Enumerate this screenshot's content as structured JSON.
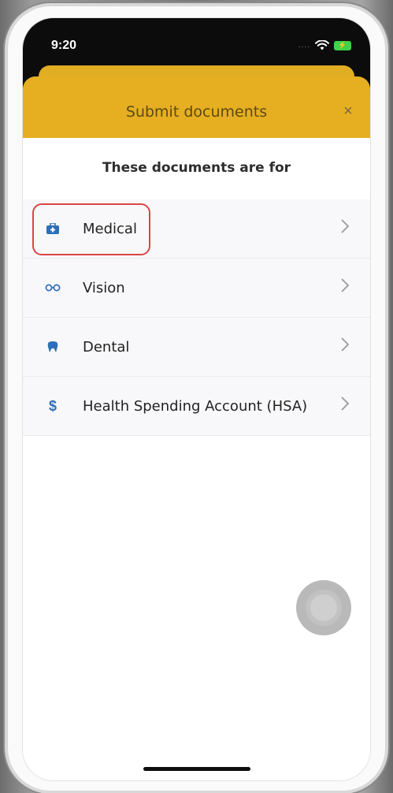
{
  "status_bar": {
    "time": "9:20",
    "signal": "....",
    "battery_symbol": "⚡"
  },
  "sheet": {
    "title": "Submit documents",
    "close_symbol": "×",
    "subtitle": "These documents are for"
  },
  "options": [
    {
      "label": "Medical",
      "icon": "medical-kit-icon",
      "highlighted": true
    },
    {
      "label": "Vision",
      "icon": "glasses-icon",
      "highlighted": false
    },
    {
      "label": "Dental",
      "icon": "tooth-icon",
      "highlighted": false
    },
    {
      "label": "Health Spending Account (HSA)",
      "icon": "dollar-icon",
      "highlighted": false
    }
  ],
  "colors": {
    "header": "#e6af22",
    "icon_blue": "#2d6fb8",
    "highlight_red": "#d94545"
  }
}
